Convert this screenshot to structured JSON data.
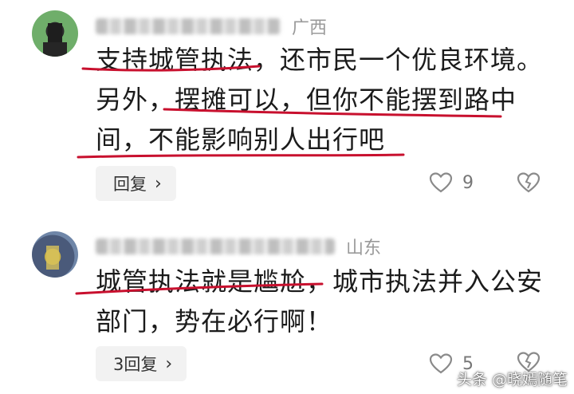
{
  "comments": [
    {
      "region": "广西",
      "lines": [
        "支持城管执法，还市民一个优良环境。",
        "另外，摆摊可以，但你不能摆到路中",
        "间，不能影响别人出行吧"
      ],
      "reply_label": "回复",
      "like_count": "9"
    },
    {
      "region": "山东",
      "lines": [
        "城管执法就是尴尬，城市执法并入公安",
        "部门，势在必行啊！"
      ],
      "reply_label": "3回复",
      "like_count": "5"
    }
  ],
  "icons": {
    "reply_chevron": "chevron-right-icon",
    "like": "heart-outline-icon",
    "dislike": "broken-heart-icon"
  },
  "colors": {
    "underline": "#c8102e",
    "meta_gray": "#9a9a9a",
    "button_bg": "#f2f2f2"
  },
  "watermark": "头条 @晓嫣随笔"
}
